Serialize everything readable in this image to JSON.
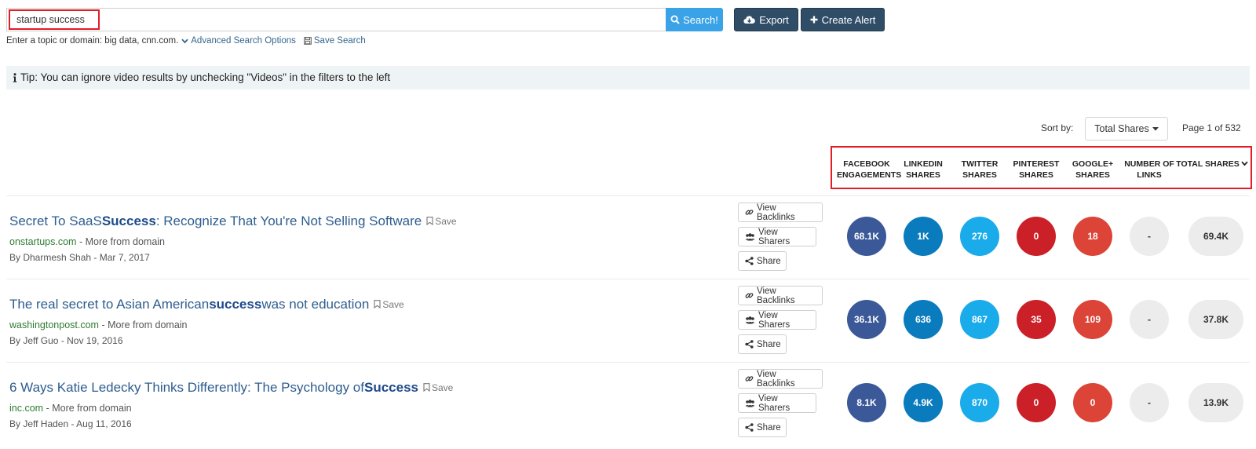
{
  "search": {
    "value": "startup success",
    "button_label": "Search!",
    "export_label": "Export",
    "alert_label": "Create Alert",
    "helper_text": "Enter a topic or domain: big data, cnn.com.",
    "advanced_label": "Advanced Search Options",
    "save_search_label": "Save Search"
  },
  "tip": {
    "icon": "info-icon",
    "text": "Tip: You can ignore video results by unchecking \"Videos\" in the filters to the left"
  },
  "sort": {
    "label": "Sort by:",
    "selected": "Total Shares",
    "page": "Page 1 of 532"
  },
  "columns": [
    {
      "line1": "Facebook",
      "line2": "Engagements"
    },
    {
      "line1": "LinkedIn",
      "line2": "Shares"
    },
    {
      "line1": "Twitter",
      "line2": "Shares"
    },
    {
      "line1": "Pinterest",
      "line2": "Shares"
    },
    {
      "line1": "Google+",
      "line2": "Shares"
    },
    {
      "line1": "Number of",
      "line2": "Links"
    },
    {
      "line1": "Total Shares",
      "line2": ""
    }
  ],
  "colors": {
    "facebook": "#3b5998",
    "linkedin": "#0a7bbd",
    "twitter": "#1aabea",
    "pinterest": "#cb2027",
    "googleplus": "#db4437",
    "neutral": "#ececec",
    "accent": "#3aa2e6",
    "highlight": "#e01e25"
  },
  "actions": {
    "backlinks": "View Backlinks",
    "sharers": "View Sharers",
    "share": "Share",
    "save": "Save",
    "more_from_domain": "- More from domain"
  },
  "results": [
    {
      "title_before": "Secret To SaaS ",
      "title_bold": "Success",
      "title_after": ": Recognize That You're Not Selling Software",
      "domain": "onstartups.com",
      "author": "By Dharmesh Shah - Mar 7, 2017",
      "metrics": [
        "68.1K",
        "1K",
        "276",
        "0",
        "18",
        "-",
        "69.4K"
      ]
    },
    {
      "title_before": "The real secret to Asian American ",
      "title_bold": "success",
      "title_after": " was not education",
      "domain": "washingtonpost.com",
      "author": "By Jeff Guo - Nov 19, 2016",
      "metrics": [
        "36.1K",
        "636",
        "867",
        "35",
        "109",
        "-",
        "37.8K"
      ]
    },
    {
      "title_before": "6 Ways Katie Ledecky Thinks Differently: The Psychology of ",
      "title_bold": "Success",
      "title_after": "",
      "domain": "inc.com",
      "author": "By Jeff Haden - Aug 11, 2016",
      "metrics": [
        "8.1K",
        "4.9K",
        "870",
        "0",
        "0",
        "-",
        "13.9K"
      ]
    }
  ]
}
